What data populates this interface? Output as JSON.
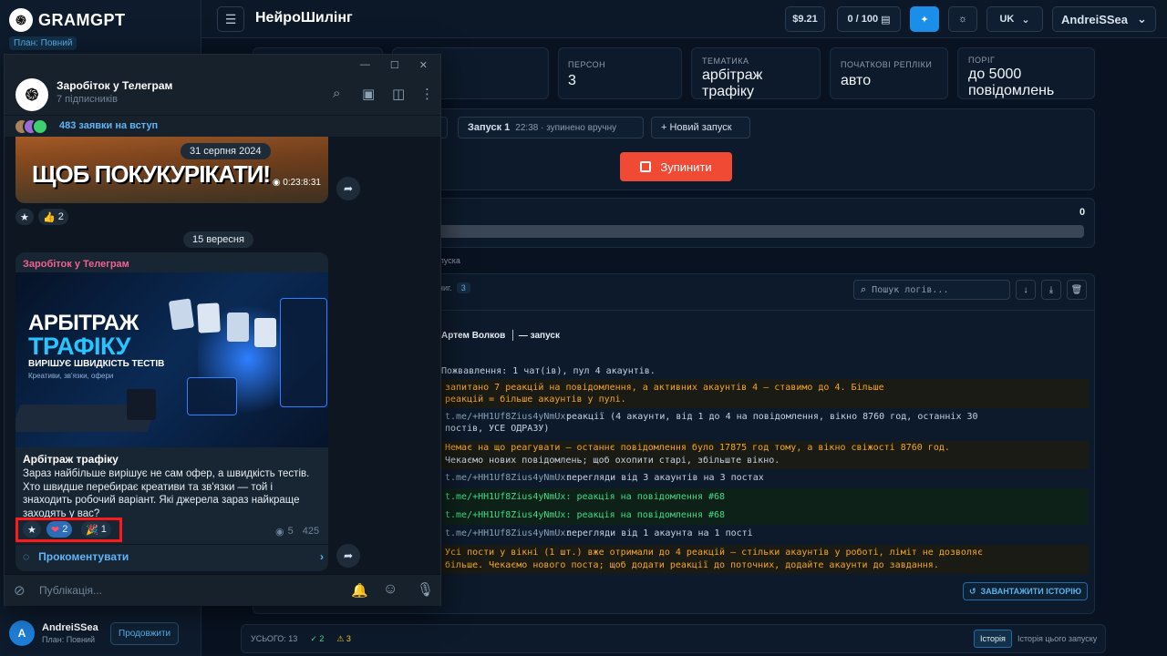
{
  "sidebar": {
    "brand": "GRAMGPT",
    "plan": "План: Повний",
    "user_initial": "A",
    "user_name": "AndreiSSea",
    "user_plan": "План: Повний",
    "renew": "Продовжити"
  },
  "header": {
    "title": "НейроШилінг",
    "balance": "$9.21",
    "quota": "0 / 100",
    "lang": "UK",
    "user": "AndreiSSea"
  },
  "stats": [
    {
      "label": "ПЕРСОН",
      "value": "3"
    },
    {
      "label": "ТЕМАТИКА",
      "value": "арбітраж трафіку"
    },
    {
      "label": "ПОЧАТКОВІ РЕПЛІКИ",
      "value": "авто"
    },
    {
      "label": "ПОРІГ",
      "value": "до 5000 повідомлень"
    }
  ],
  "runs": {
    "run_label": "Запуск 1",
    "run_time": "22:38 · зупинено вручну",
    "new_run": "+ Новий запуск",
    "stop": "Зупинити"
  },
  "progress": {
    "value": "0",
    "fraction": 0
  },
  "log": {
    "fragment_label": "пуска",
    "tab_fragment": "ниг.",
    "tab_count": "3",
    "search_placeholder": "Пошук логів...",
    "header_line": "Артем Волков  │ — запуск",
    "lines": [
      "Пожвавлення: 1 чат(ів), пул 4 акаунтів.",
      "запитано 7 реакцій на повідомлення, а активних акаунтів 4 — ставимо до 4. Більше",
      "реакцій = більше акаунтів у пулі.",
      "t.me/+HH1Uf8Zius4yNmUx:",
      "реакції (4 акаунти, від 1 до 4 на повідомлення, вікно 8760 год, останніх 30",
      "постів, УСЕ ОДРАЗУ)",
      "Немає на що реагувати — останнє повідомлення було 17875 год тому, а вікно свіжості 8760 год.",
      "Чекаємо нових повідомлень; щоб охопити старі, збільште вікно.",
      "перегляди від 3 акаунтів на 3 постах",
      "t.me/+HH1Uf8Zius4yNmUx: реакція на повідомлення #68",
      "t.me/+HH1Uf8Zius4yNmUx: реакція на повідомлення #68",
      "перегляди від 1 акаунта на 1 пості",
      "Усі пости у вікні (1 шт.) вже отримали до 4 реакцій — стільки акаунтів у роботі, ліміт не дозволяє",
      "більше. Чекаємо нового поста; щоб додати реакції до поточних, додайте акаунти до завдання."
    ],
    "load_history": "ЗАВАНТАЖИТИ ІСТОРІЮ"
  },
  "footer": {
    "total_label": "УСЬОГО: 13",
    "ok_count": "✓ 2",
    "warn_count": "⚠ 3",
    "history_tab": "Історія",
    "history_desc": "Історія цього запуску"
  },
  "telegram": {
    "channel": "Заробіток у Телеграм",
    "subscribers": "7 підписників",
    "join_requests": "483 заявки на вступ",
    "date1": "31 серпня 2024",
    "video_caption": "ЩОБ ПОКУКУРІКАТИ!",
    "video_time": "0:23:8:31",
    "react1_count": "2",
    "date2": "15 вересня",
    "post_author": "Заробіток у Телеграм",
    "banner_title1": "АРБІТРАЖ",
    "banner_title2": "ТРАФІКУ",
    "banner_sub": "ВИРІШУЄ ШВИДКІСТЬ ТЕСТІВ",
    "banner_small": "Креативи, зв'язки, офери",
    "post_title": "Арбітраж трафіку",
    "post_text": "Зараз найбільше вирішує не сам офер, а швидкість тестів. Хто швидше перебирає креативи та зв'язки — той і знаходить робочий варіант. Які джерела зараз найкраще заходять у вас?",
    "heart_count": "2",
    "party_count": "1",
    "views": "5",
    "time": "425",
    "comment": "Прокоментувати",
    "input_placeholder": "Публікація..."
  }
}
